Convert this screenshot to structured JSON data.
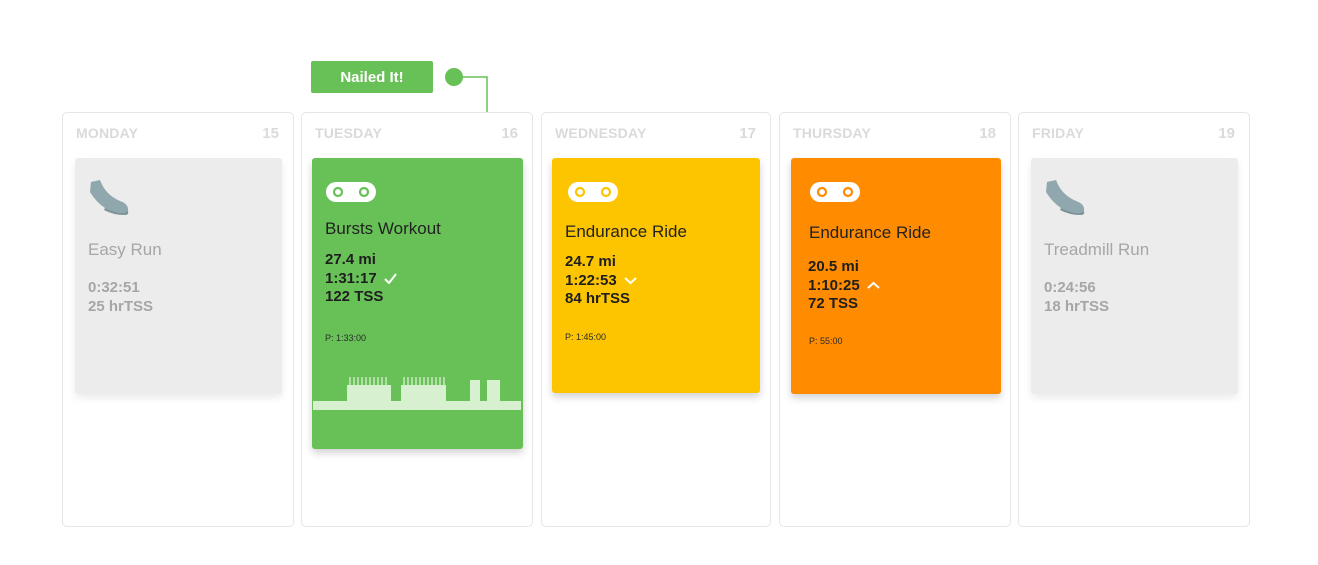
{
  "callout": {
    "label": "Nailed It!"
  },
  "days": [
    {
      "name": "MONDAY",
      "number": "15"
    },
    {
      "name": "TUESDAY",
      "number": "16"
    },
    {
      "name": "WEDNESDAY",
      "number": "17"
    },
    {
      "name": "THURSDAY",
      "number": "18"
    },
    {
      "name": "FRIDAY",
      "number": "19"
    }
  ],
  "workouts": [
    {
      "sport_icon": "shoe-icon",
      "title": "Easy Run",
      "duration": "0:32:51",
      "load": "25 hrTSS",
      "color": "#ececec"
    },
    {
      "sport_icon": "bike-chain-icon",
      "title": "Bursts Workout",
      "distance": "27.4 mi",
      "duration": "1:31:17",
      "status_icon": "check-icon",
      "load": "122 TSS",
      "planned": "P: 1:33:00",
      "color": "#68c157"
    },
    {
      "sport_icon": "bike-chain-icon",
      "title": "Endurance Ride",
      "distance": "24.7 mi",
      "duration": "1:22:53",
      "status_icon": "chevron-down-icon",
      "load": "84 hrTSS",
      "planned": "P: 1:45:00",
      "color": "#fdc500"
    },
    {
      "sport_icon": "bike-chain-icon",
      "title": "Endurance Ride",
      "distance": "20.5 mi",
      "duration": "1:10:25",
      "status_icon": "chevron-up-icon",
      "load": "72 TSS",
      "planned": "P: 55:00",
      "color": "#ff8c00"
    },
    {
      "sport_icon": "shoe-icon",
      "title": "Treadmill Run",
      "duration": "0:24:56",
      "load": "18 hrTSS",
      "color": "#ececec"
    }
  ]
}
